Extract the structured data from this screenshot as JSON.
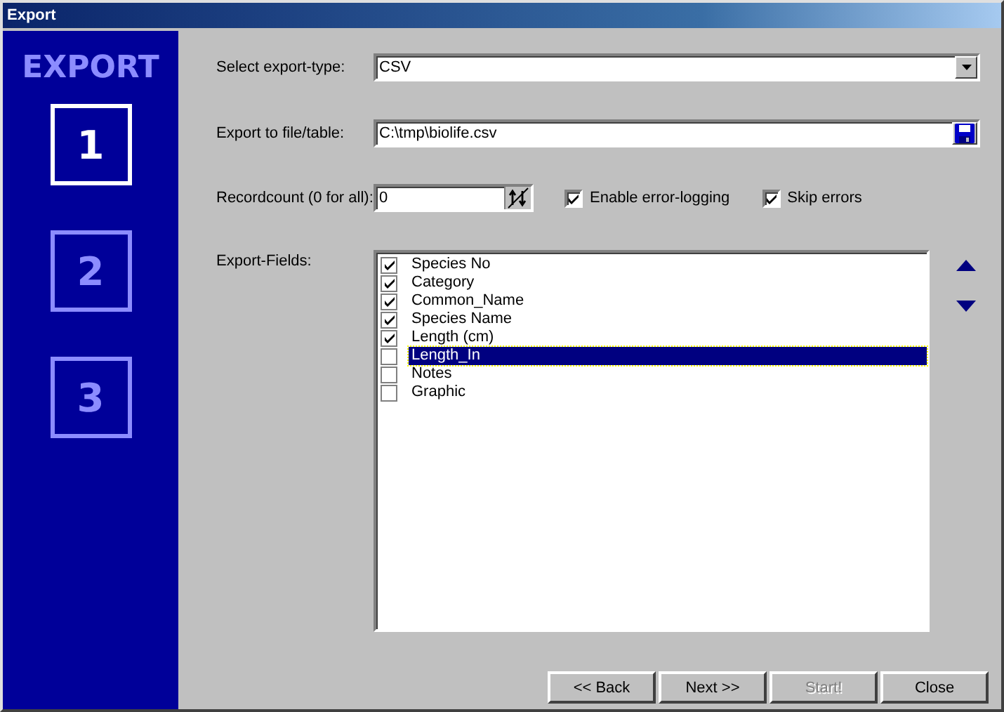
{
  "window": {
    "title": "Export"
  },
  "sidebar": {
    "heading": "EXPORT",
    "steps": [
      {
        "label": "1",
        "selected": true
      },
      {
        "label": "2",
        "selected": false
      },
      {
        "label": "3",
        "selected": false
      }
    ]
  },
  "export_type": {
    "label": "Select export-type:",
    "value": "CSV"
  },
  "export_file": {
    "label": "Export to file/table:",
    "value": "C:\\tmp\\biolife.csv"
  },
  "recordcount": {
    "label": "Recordcount (0 for all):",
    "value": "0"
  },
  "options": [
    {
      "label": "Enable error-logging",
      "checked": true
    },
    {
      "label": "Skip errors",
      "checked": true
    }
  ],
  "export_fields": {
    "label": "Export-Fields:",
    "items": [
      {
        "label": "Species No",
        "checked": true,
        "selected": false
      },
      {
        "label": "Category",
        "checked": true,
        "selected": false
      },
      {
        "label": "Common_Name",
        "checked": true,
        "selected": false
      },
      {
        "label": "Species Name",
        "checked": true,
        "selected": false
      },
      {
        "label": "Length (cm)",
        "checked": true,
        "selected": false
      },
      {
        "label": "Length_In",
        "checked": false,
        "selected": true
      },
      {
        "label": "Notes",
        "checked": false,
        "selected": false
      },
      {
        "label": "Graphic",
        "checked": false,
        "selected": false
      }
    ]
  },
  "buttons": [
    {
      "label": "<< Back",
      "disabled": false
    },
    {
      "label": "Next >>",
      "disabled": false
    },
    {
      "label": "Start!",
      "disabled": true
    },
    {
      "label": "Close",
      "disabled": false
    }
  ]
}
